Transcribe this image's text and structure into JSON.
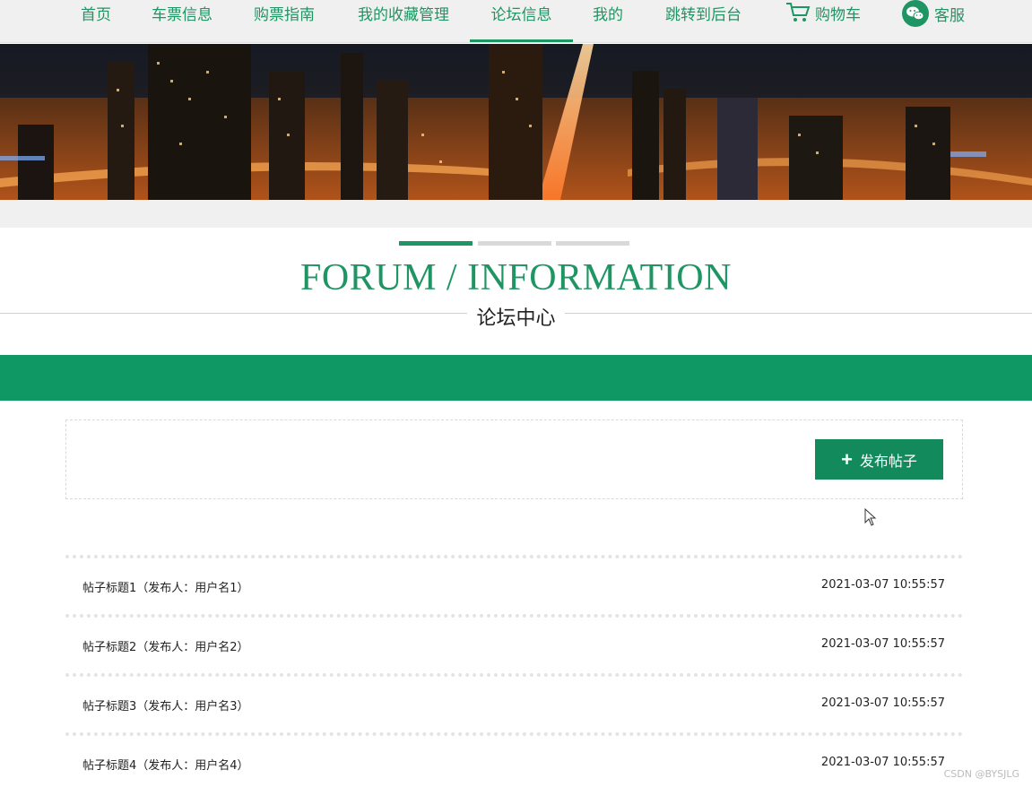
{
  "nav": {
    "items": [
      {
        "label": "首页"
      },
      {
        "label": "车票信息"
      },
      {
        "label": "购票指南"
      },
      {
        "label": "我的收藏管理"
      },
      {
        "label": "论坛信息",
        "active": true
      },
      {
        "label": "我的"
      },
      {
        "label": "跳转到后台"
      },
      {
        "label": "购物车",
        "icon": "shopping-cart-icon"
      },
      {
        "label": "客服",
        "icon": "wechat-icon"
      }
    ]
  },
  "banner": {
    "alt": "city night skyline"
  },
  "section": {
    "title_en": "FORUM / INFORMATION",
    "title_cn": "论坛中心"
  },
  "toolbar": {
    "publish_label": "发布帖子",
    "publish_icon": "plus-icon"
  },
  "posts": [
    {
      "title": "帖子标题1（发布人：用户名1）",
      "time": "2021-03-07 10:55:57"
    },
    {
      "title": "帖子标题2（发布人：用户名2）",
      "time": "2021-03-07 10:55:57"
    },
    {
      "title": "帖子标题3（发布人：用户名3）",
      "time": "2021-03-07 10:55:57"
    },
    {
      "title": "帖子标题4（发布人：用户名4）",
      "time": "2021-03-07 10:55:57"
    }
  ],
  "watermark": "CSDN @BYSJLG",
  "colors": {
    "accent": "#1e9563",
    "band": "#0f9863",
    "button": "#128a5c"
  }
}
